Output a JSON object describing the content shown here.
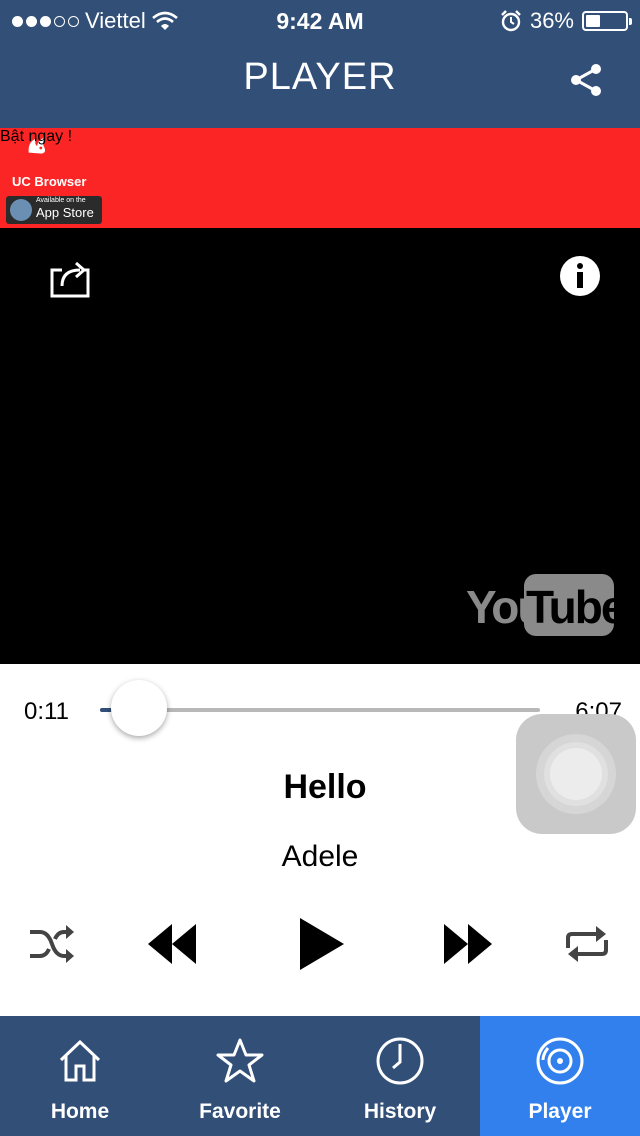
{
  "status_bar": {
    "carrier": "Viettel",
    "signal_bars_filled": 3,
    "signal_bars_total": 5,
    "time": "9:42 AM",
    "battery_percent": "36%",
    "battery_level": 0.36
  },
  "header": {
    "title": "PLAYER",
    "share_icon": "share-icon"
  },
  "ad_banner": {
    "brand": "UC Browser",
    "store_small": "Available on the",
    "store": "App Store",
    "cta": "Bật ngay !"
  },
  "video": {
    "share_icon": "share-out-icon",
    "info_icon": "info-icon",
    "watermark_you": "You",
    "watermark_tube": "Tube"
  },
  "player": {
    "current_time": "0:11",
    "total_time": "6:07",
    "progress": 0.03,
    "title": "Hello",
    "artist": "Adele",
    "controls": [
      "shuffle-icon",
      "rewind-icon",
      "play-icon",
      "fast-forward-icon",
      "repeat-icon"
    ]
  },
  "tabs": [
    {
      "label": "Home",
      "icon": "home-icon",
      "active": false
    },
    {
      "label": "Favorite",
      "icon": "star-icon",
      "active": false
    },
    {
      "label": "History",
      "icon": "clock-icon",
      "active": false
    },
    {
      "label": "Player",
      "icon": "disc-icon",
      "active": true
    }
  ],
  "colors": {
    "primary": "#324f78",
    "active_tab": "#3280ee",
    "ad_red": "#fb2525"
  }
}
